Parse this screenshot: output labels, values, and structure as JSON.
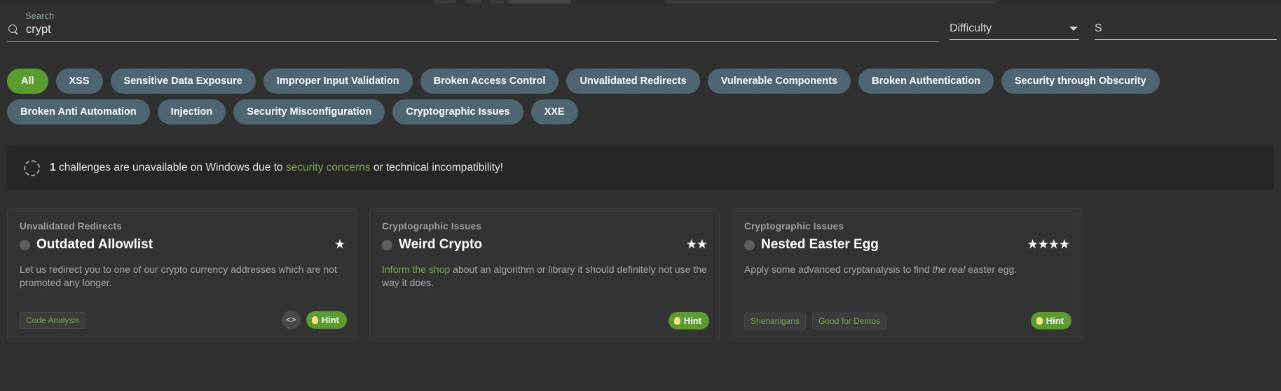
{
  "search": {
    "label": "Search",
    "value": "crypt",
    "icon": "search-icon"
  },
  "difficulty": {
    "label": "Difficulty",
    "icon": "chevron-down-icon"
  },
  "status_filter": {
    "label": "S"
  },
  "chips": {
    "row1": [
      {
        "label": "All",
        "selected": true
      },
      {
        "label": "XSS",
        "selected": false
      },
      {
        "label": "Sensitive Data Exposure",
        "selected": false
      },
      {
        "label": "Improper Input Validation",
        "selected": false
      },
      {
        "label": "Broken Access Control",
        "selected": false
      },
      {
        "label": "Unvalidated Redirects",
        "selected": false
      },
      {
        "label": "Vulnerable Components",
        "selected": false
      },
      {
        "label": "Broken Authentication",
        "selected": false
      },
      {
        "label": "Security through Obscurity",
        "selected": false
      }
    ],
    "row2": [
      {
        "label": "Broken Anti Automation",
        "selected": false
      },
      {
        "label": "Injection",
        "selected": false
      },
      {
        "label": "Security Misconfiguration",
        "selected": false
      },
      {
        "label": "Cryptographic Issues",
        "selected": false
      },
      {
        "label": "XXE",
        "selected": false
      }
    ]
  },
  "banner": {
    "icon": "spinner-icon",
    "count": "1",
    "text_before": "challenges are unavailable on Windows due to",
    "link": "security concerns",
    "text_after": "or technical incompatibility!"
  },
  "cards": [
    {
      "category": "Unvalidated Redirects",
      "title": "Outdated Allowlist",
      "stars": "★",
      "star_count": 1,
      "desc_parts": [
        {
          "type": "text",
          "text": "Let us redirect you to one of our crypto currency addresses which are not promoted any longer."
        }
      ],
      "tags": [
        "Code Analysis"
      ],
      "has_code_button": true,
      "code_label": "<>",
      "hint_label": "Hint"
    },
    {
      "category": "Cryptographic Issues",
      "title": "Weird Crypto",
      "stars": "★★",
      "star_count": 2,
      "desc_parts": [
        {
          "type": "link",
          "text": "Inform the shop"
        },
        {
          "type": "text",
          "text": " about an algorithm or library it should definitely not use the way it does."
        }
      ],
      "tags": [],
      "has_code_button": false,
      "code_label": "",
      "hint_label": "Hint"
    },
    {
      "category": "Cryptographic Issues",
      "title": "Nested Easter Egg",
      "stars": "★★★★",
      "star_count": 4,
      "desc_parts": [
        {
          "type": "text",
          "text": "Apply some advanced cryptanalysis to find "
        },
        {
          "type": "em",
          "text": "the real"
        },
        {
          "type": "text",
          "text": " easter egg."
        }
      ],
      "tags": [
        "Shenanigans",
        "Good for Demos"
      ],
      "has_code_button": false,
      "code_label": "",
      "hint_label": "Hint"
    }
  ],
  "colors": {
    "background": "#303030",
    "card_background": "#333333",
    "chip": "#4e6671",
    "chip_selected": "#5a9c2e",
    "accent_green": "#5a9c2e",
    "link_green": "#7aab4a",
    "banner_background": "#262626"
  }
}
